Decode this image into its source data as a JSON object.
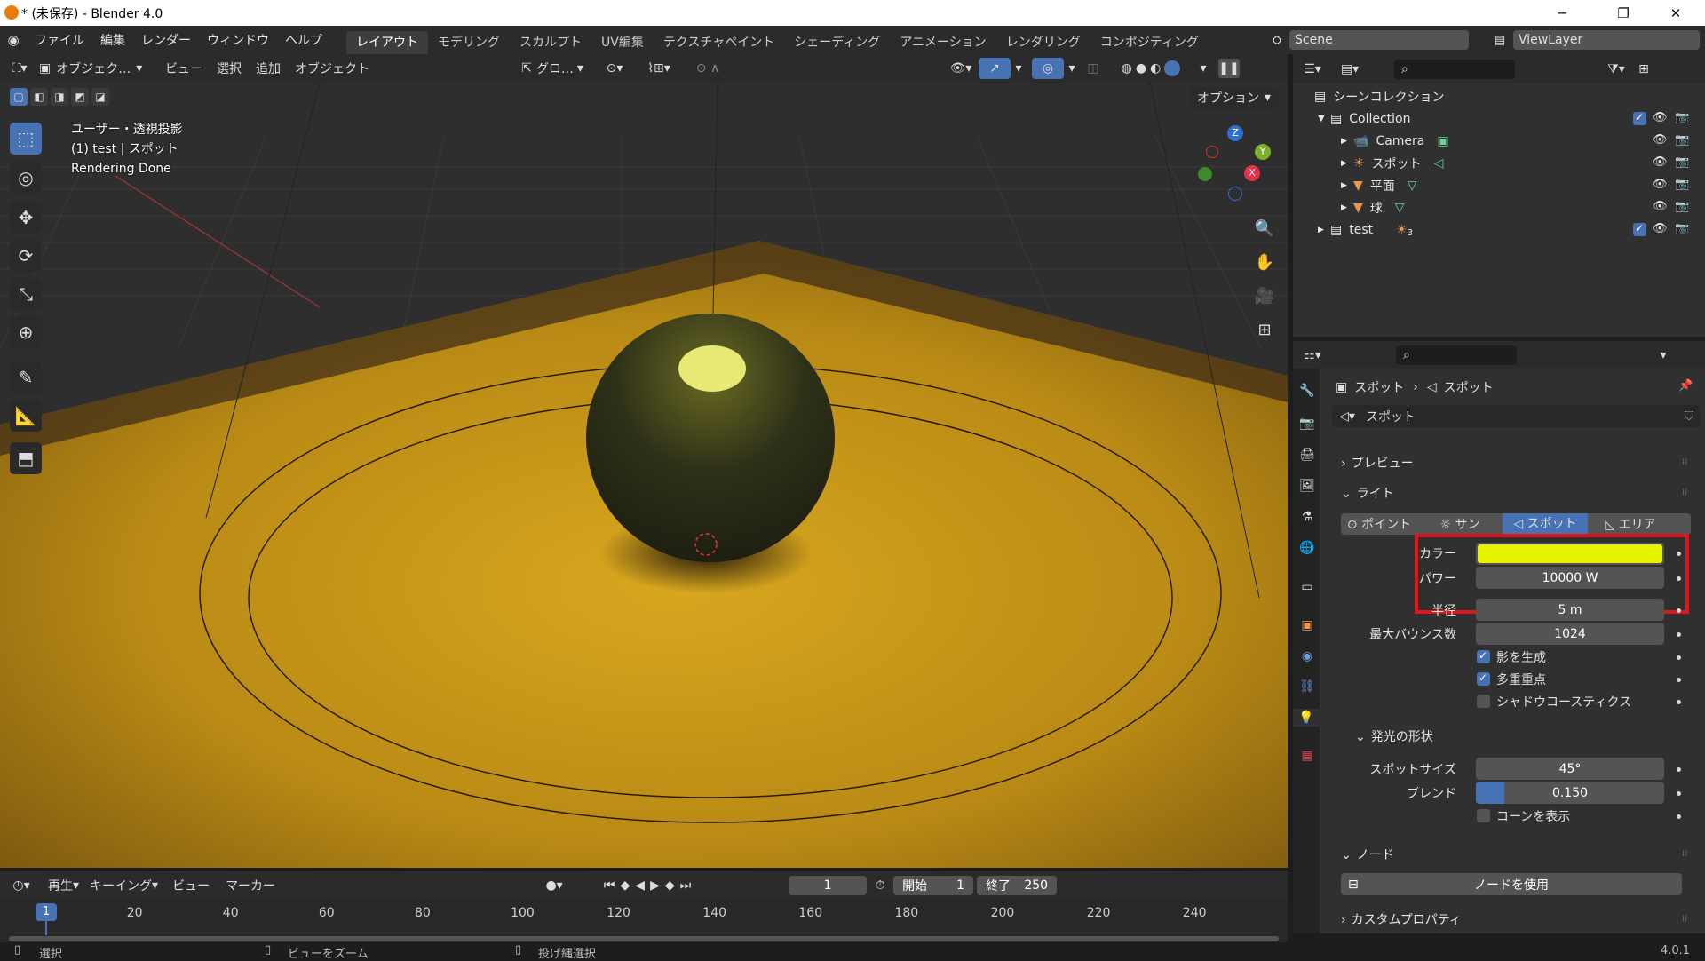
{
  "window": {
    "title": "* (未保存) - Blender 4.0",
    "minimize": "─",
    "maximize": "❐",
    "close": "✕"
  },
  "menu": [
    "ファイル",
    "編集",
    "レンダー",
    "ウィンドウ",
    "ヘルプ"
  ],
  "workspaces": [
    "レイアウト",
    "モデリング",
    "スカルプト",
    "UV編集",
    "テクスチャペイント",
    "シェーディング",
    "アニメーション",
    "レンダリング",
    "コンポジティング"
  ],
  "scene": {
    "name": "Scene",
    "view_layer": "ViewLayer"
  },
  "viewport_header": {
    "mode": "オブジェク…",
    "menus": [
      "ビュー",
      "選択",
      "追加",
      "オブジェクト"
    ],
    "transform": "グロ…",
    "options": "オプション"
  },
  "viewport_overlay": {
    "line1": "ユーザー・透視投影",
    "line2": "(1) test | スポット",
    "line3": "Rendering Done"
  },
  "gizmo": {
    "x": "X",
    "y": "Y",
    "z": "Z"
  },
  "outliner": {
    "root": "シーンコレクション",
    "collection": "Collection",
    "items": [
      "Camera",
      "スポット",
      "平面",
      "球"
    ],
    "test": "test",
    "test_badge": "3"
  },
  "properties": {
    "breadcrumb_obj": "スポット",
    "breadcrumb_data": "スポット",
    "datablock": "スポット",
    "panel_preview": "プレビュー",
    "panel_light": "ライト",
    "light_types": [
      "ポイント",
      "サン",
      "スポット",
      "エリア"
    ],
    "active_light_type": "スポット",
    "color_label": "カラー",
    "color_value": "#e6f200",
    "power_label": "パワー",
    "power_value": "10000 W",
    "radius_label": "半径",
    "radius_value": "5 m",
    "bounces_label": "最大バウンス数",
    "bounces_value": "1024",
    "cast_shadow": "影を生成",
    "multiple_importance": "多重重点",
    "shadow_caustics": "シャドウコースティクス",
    "panel_beam": "発光の形状",
    "spot_size_label": "スポットサイズ",
    "spot_size_value": "45°",
    "blend_label": "ブレンド",
    "blend_value": "0.150",
    "blend_fraction": 0.15,
    "show_cone": "コーンを表示",
    "panel_nodes": "ノード",
    "use_nodes": "ノードを使用",
    "panel_custom": "カスタムプロパティ"
  },
  "timeline": {
    "menus": [
      "再生",
      "キーイング",
      "ビュー",
      "マーカー"
    ],
    "current_frame": "1",
    "start_label": "開始",
    "start_value": "1",
    "end_label": "終了",
    "end_value": "250",
    "ticks": [
      "1",
      "20",
      "40",
      "60",
      "80",
      "100",
      "120",
      "140",
      "160",
      "180",
      "200",
      "220",
      "240"
    ]
  },
  "status": {
    "select": "選択",
    "zoom": "ビューをズーム",
    "lasso": "投げ縄選択",
    "version": "4.0.1"
  },
  "colors": {
    "accent": "#4772b3",
    "highlight_box": "#e0151b",
    "floor": "#c4951a"
  }
}
